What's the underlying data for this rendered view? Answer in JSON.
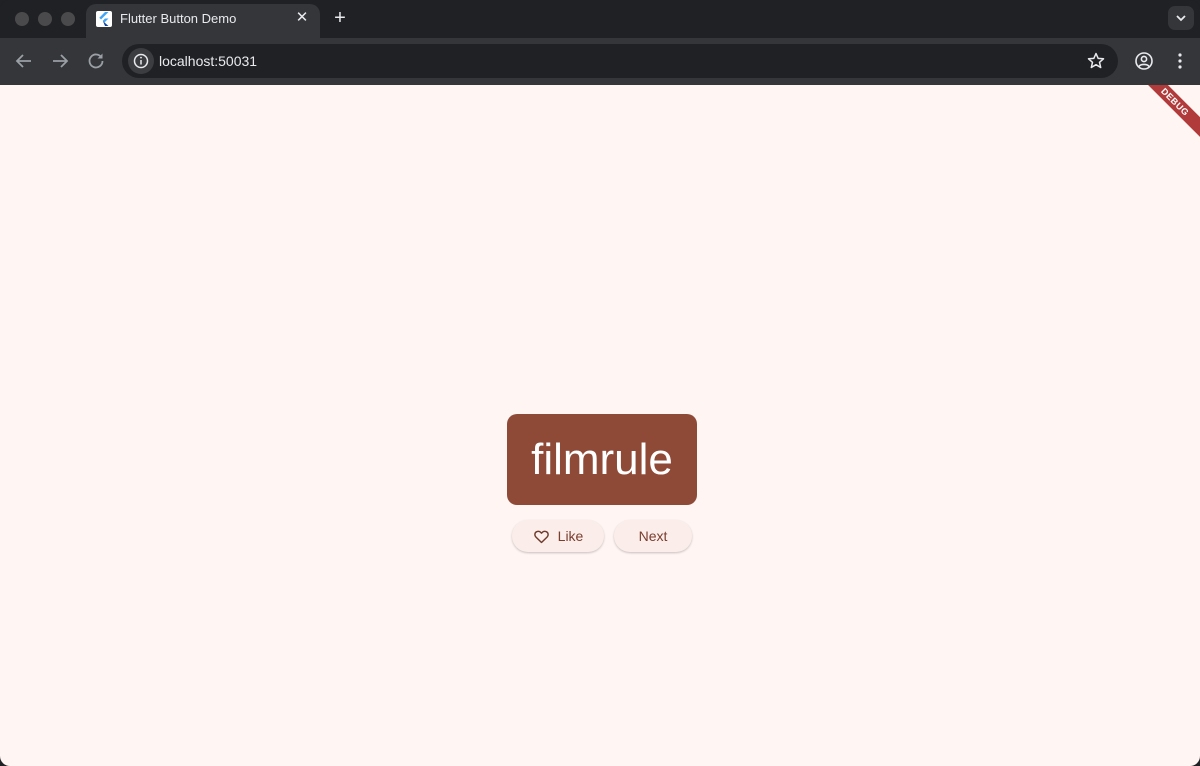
{
  "browser": {
    "tab": {
      "title": "Flutter Button Demo"
    },
    "address": {
      "url": "localhost:50031"
    }
  },
  "app": {
    "debug_banner": "DEBUG",
    "word": "filmrule",
    "buttons": {
      "like_label": "Like",
      "next_label": "Next"
    }
  },
  "colors": {
    "page_background": "#fff5f3",
    "card_background": "#8f4a37",
    "button_background": "#fbeeea",
    "button_text": "#7a3d2e",
    "debug_banner": "#b13b3b"
  }
}
